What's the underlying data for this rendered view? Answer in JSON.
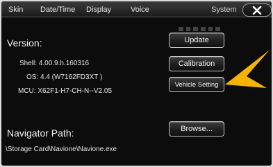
{
  "tabs": [
    {
      "label": "Skin"
    },
    {
      "label": "Date/Time"
    },
    {
      "label": "Display"
    },
    {
      "label": "Voice"
    }
  ],
  "system_tab": {
    "label": "System"
  },
  "close_button": {
    "icon": "close-icon"
  },
  "version": {
    "title": "Version:",
    "shell": "Shell: 4.00.9.h.160316",
    "os": "OS:  4.4 (W7162FD3XT  )",
    "mcu": "MCU:  X62F1-H7-CH-N--V2.05"
  },
  "buttons": {
    "update": "Update",
    "calibration": "Calibration",
    "vehicle_setting": "Vehicle Setting",
    "browse": "Browse..."
  },
  "navigator": {
    "title": "Navigator Path:",
    "path": "\\Storage Card\\Navione\\Navione.exe"
  },
  "colors": {
    "arrow": "#f5b400",
    "background": "#0c0c0c"
  }
}
